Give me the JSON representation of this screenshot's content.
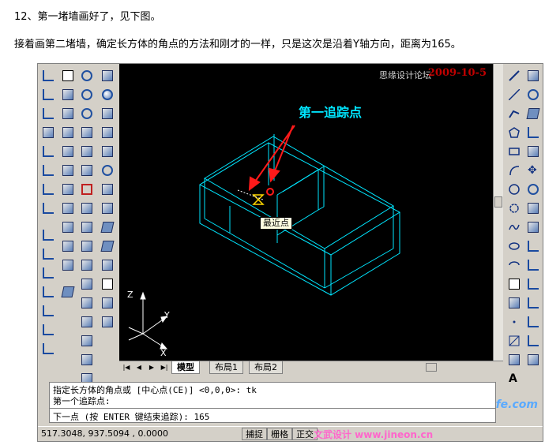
{
  "article": {
    "step_line": "12、第一堵墙画好了，见下图。",
    "instruction_line": "接着画第二堵墙，确定长方体的角点的方法和刚才的一样，只是这次是沿着Y轴方向，距离为165。"
  },
  "watermark": {
    "site": "思缘设计论坛",
    "date": "2009-10-5"
  },
  "drawing": {
    "annotation": "第一追踪点",
    "tooltip": "最近点",
    "ucs": {
      "z": "Z",
      "y": "Y",
      "x": "X"
    },
    "colors": {
      "wire": "#00e6ff",
      "arrow": "#ff1a1a",
      "marker": "#ffd800"
    }
  },
  "layout_tabs": {
    "model": "模型",
    "layout1": "布局1",
    "layout2": "布局2"
  },
  "command": {
    "history_1": "指定长方体的角点或 [中心点(CE)] <0,0,0>: tk",
    "history_2": "第一个追踪点:",
    "current": "下一点 (按 ENTER 键结束追踪): 165"
  },
  "status": {
    "coords": "517.3048,  937.5094 , 0.0000",
    "snap": "捕捉",
    "grid": "栅格",
    "ortho": "正交",
    "overlay_watermark": "文武设计 www.jineon.cn",
    "corner_watermark": "fe.com"
  }
}
